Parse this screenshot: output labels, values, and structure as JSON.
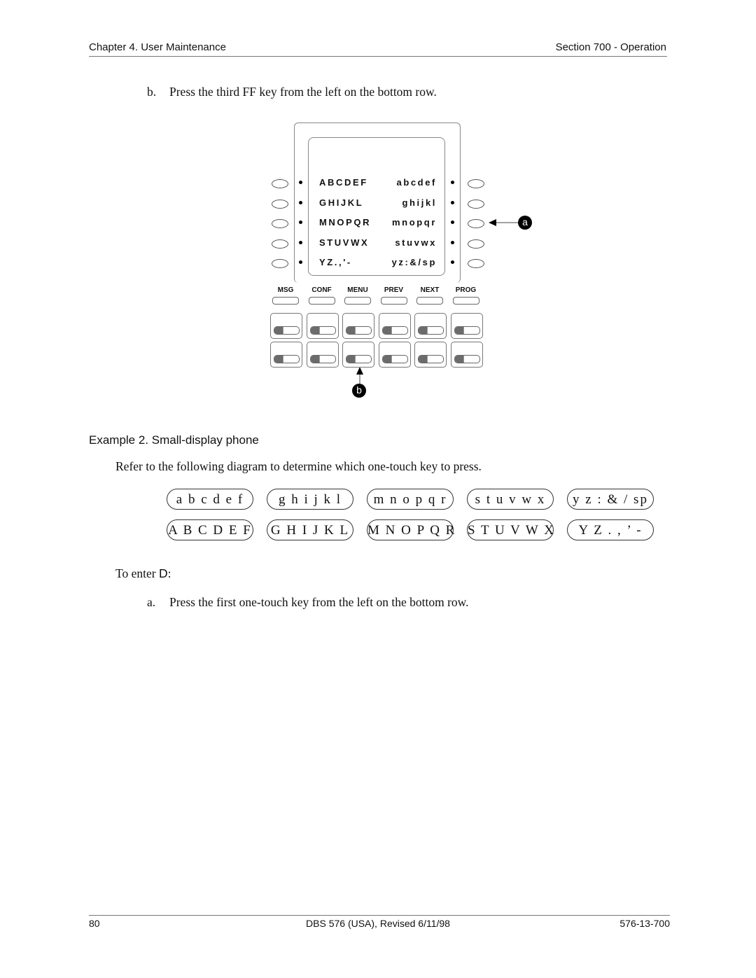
{
  "header": {
    "left": "Chapter 4. User Maintenance",
    "right": "Section 700 - Operation"
  },
  "step_b": {
    "label": "b.",
    "text": "Press the third FF key from the left on the bottom row."
  },
  "phone_diagram": {
    "lcd_rows": [
      {
        "upper": "ABCDEF",
        "lower": "abcdef"
      },
      {
        "upper": "GHIJKL",
        "lower": "ghijkl"
      },
      {
        "upper": "MNOPQR",
        "lower": "mnopqr"
      },
      {
        "upper": "STUVWX",
        "lower": "stuvwx"
      },
      {
        "upper": "YZ.,'-",
        "lower": "yz:&/sp"
      }
    ],
    "function_keys": [
      "MSG",
      "CONF",
      "MENU",
      "PREV",
      "NEXT",
      "PROG"
    ],
    "ff_key_rows": 2,
    "ff_keys_per_row": 6,
    "callout_a": "a",
    "callout_b": "b"
  },
  "example2": {
    "title": "Example 2. Small-display phone",
    "intro": "Refer to the following diagram to determine which one-touch key to press.",
    "keys_top": [
      "a b c d e f",
      "g h i j k l",
      "m n o p q r",
      "s t u v w x",
      "y z : & / sp"
    ],
    "keys_bottom": [
      "A B C D E F",
      "G H I J K L",
      "M N O P Q R",
      "S T U V W X",
      "Y Z . , ’ -"
    ]
  },
  "to_enter": {
    "prefix": "To enter ",
    "char": "D",
    "suffix": ":"
  },
  "step_a": {
    "label": "a.",
    "text": "Press the first one-touch key from the left on the bottom row."
  },
  "footer": {
    "page": "80",
    "center": "DBS 576 (USA), Revised 6/11/98",
    "right": "576-13-700"
  }
}
